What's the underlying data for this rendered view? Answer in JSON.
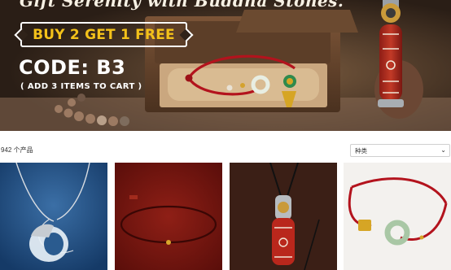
{
  "hero": {
    "tagline": "Gift Serenity with Buddha Stones.",
    "offer": "BUY 2 GET 1 FREE",
    "code": "CODE: B3",
    "note": "( ADD 3 ITEMS TO CART )"
  },
  "toolbar": {
    "product_count": "942 个产品",
    "sort_label": "种类"
  },
  "products": [
    {
      "image": "white-jade-crescent-pendant-necklace"
    },
    {
      "image": "red-string-gold-bead-bracelet"
    },
    {
      "image": "dzi-bead-buddha-pendant-necklace"
    },
    {
      "image": "red-string-jade-donut-bracelet"
    }
  ],
  "colors": {
    "accent_yellow": "#f3c11a",
    "string_red": "#b3131d"
  }
}
